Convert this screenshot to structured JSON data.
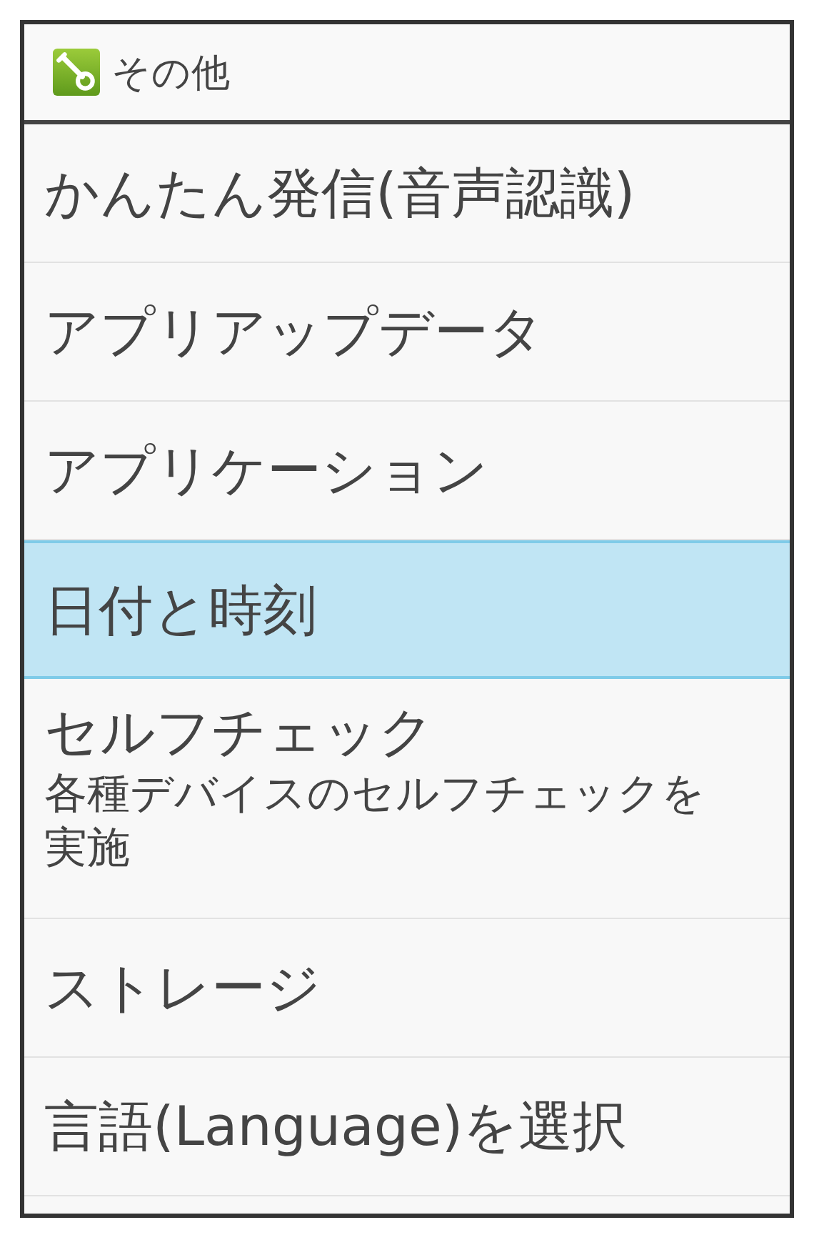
{
  "header": {
    "title": "その他"
  },
  "items": [
    {
      "title": "かんたん発信(音声認識)",
      "selected": false
    },
    {
      "title": "アプリアップデータ",
      "selected": false
    },
    {
      "title": "アプリケーション",
      "selected": false
    },
    {
      "title": "日付と時刻",
      "selected": true
    },
    {
      "title": "セルフチェック",
      "summary": "各種デバイスのセルフチェックを実施",
      "selected": false
    },
    {
      "title": "ストレージ",
      "selected": false
    },
    {
      "title": "言語(Language)を選択",
      "selected": false
    }
  ]
}
